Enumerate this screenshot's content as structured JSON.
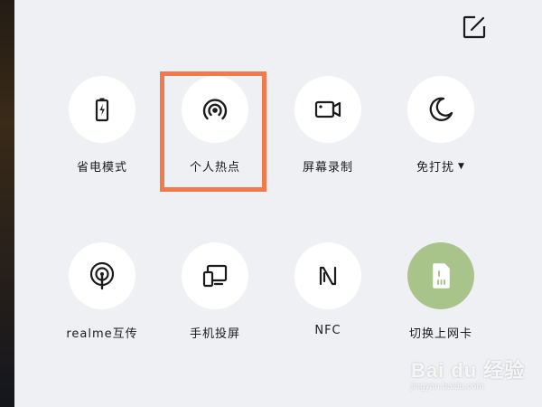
{
  "tiles": [
    {
      "label": "省电模式",
      "icon": "battery-saver-icon"
    },
    {
      "label": "个人热点",
      "icon": "hotspot-icon"
    },
    {
      "label": "屏幕录制",
      "icon": "screen-record-icon"
    },
    {
      "label": "免打扰",
      "icon": "moon-icon",
      "has_dropdown": true
    },
    {
      "label": "realme互传",
      "icon": "share-icon"
    },
    {
      "label": "手机投屏",
      "icon": "screen-cast-icon"
    },
    {
      "label": "NFC",
      "icon": "nfc-icon"
    },
    {
      "label": "切换上网卡",
      "icon": "sim-card-icon",
      "active": true
    }
  ],
  "edit": {
    "icon": "edit-icon"
  },
  "watermark": {
    "logo": "Bai du 经验",
    "url": "jingyan.baidu.com"
  },
  "colors": {
    "panel": "#eff0f4",
    "circle": "#ffffff",
    "active_circle": "#a8c48a",
    "highlight": "#f07a4c",
    "icon": "#1b1b1b"
  }
}
